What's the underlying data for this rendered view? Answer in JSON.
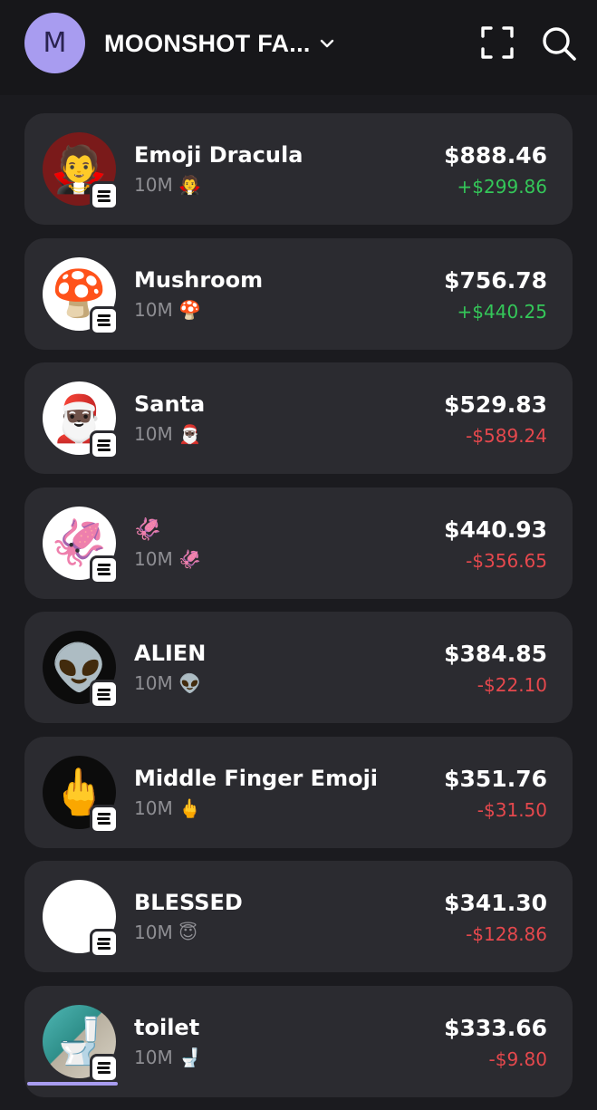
{
  "header": {
    "avatar_letter": "M",
    "wallet_name": "MOONSHOT FA...",
    "icons": [
      "chevron-down-icon",
      "scan-icon",
      "search-icon"
    ]
  },
  "tokens": [
    {
      "name": "Emoji Dracula",
      "amount": "10M",
      "emoji": "🧛",
      "price": "$888.46",
      "change": "+$299.86",
      "direction": "up"
    },
    {
      "name": "Mushroom",
      "amount": "10M",
      "emoji": "🍄",
      "price": "$756.78",
      "change": "+$440.25",
      "direction": "up"
    },
    {
      "name": "Santa",
      "amount": "10M",
      "emoji": "🎅🏿",
      "price": "$529.83",
      "change": "-$589.24",
      "direction": "down"
    },
    {
      "name": "🦑",
      "amount": "10M",
      "emoji": "🦑",
      "price": "$440.93",
      "change": "-$356.65",
      "direction": "down"
    },
    {
      "name": "ALIEN",
      "amount": "10M",
      "emoji": "👽",
      "price": "$384.85",
      "change": "-$22.10",
      "direction": "down"
    },
    {
      "name": "Middle Finger Emoji",
      "amount": "10M",
      "emoji": "🖕",
      "price": "$351.76",
      "change": "-$31.50",
      "direction": "down"
    },
    {
      "name": "BLESSED",
      "amount": "10M",
      "emoji": "😇",
      "price": "$341.30",
      "change": "-$128.86",
      "direction": "down"
    },
    {
      "name": "toilet",
      "amount": "10M",
      "emoji": "🚽",
      "price": "$333.66",
      "change": "-$9.80",
      "direction": "down"
    }
  ],
  "colors": {
    "background": "#1b1b1f",
    "card": "#2b2b30",
    "accent": "#a89cf0",
    "positive": "#34c759",
    "negative": "#e5484d"
  }
}
